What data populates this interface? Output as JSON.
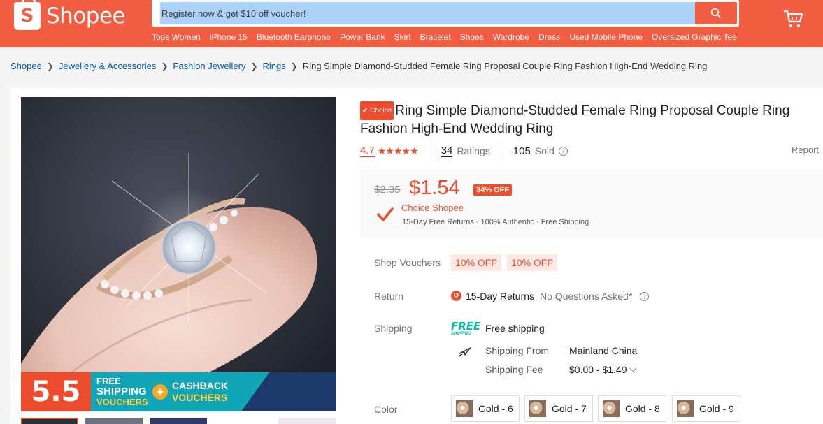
{
  "header": {
    "logo_text": "Shopee",
    "search_placeholder": "Register now & get $10 off voucher!",
    "hot_words": [
      "Tops Women",
      "iPhone 15",
      "Bluetooth Earphone",
      "Power Bank",
      "Skirt",
      "Bracelet",
      "Shoes",
      "Wardrobe",
      "Dress",
      "Used Mobile Phone",
      "Oversized Graphic Tee"
    ]
  },
  "breadcrumb": {
    "items": [
      "Shopee",
      "Jewellery & Accessories",
      "Fashion Jewellery",
      "Rings"
    ],
    "current": "Ring Simple Diamond-Studded Female Ring Proposal Couple Ring Fashion High-End Wedding Ring"
  },
  "product": {
    "badge": "✔ Choice",
    "title": "Ring Simple Diamond-Studded Female Ring Proposal Couple Ring Fashion High-End Wedding Ring",
    "rating": "4.7",
    "stars": 4.7,
    "ratings_count": "34",
    "ratings_label": "Ratings",
    "sold_count": "105",
    "sold_label": "Sold",
    "report": "Report",
    "old_price": "$2.35",
    "price": "$1.54",
    "discount": "34% OFF",
    "choice_title": "Choice Shopee",
    "choice_sub": "15-Day Free Returns · 100% Authentic · Free Shipping"
  },
  "banner": {
    "big": "5.5",
    "left_top": "FREE",
    "left_mid": "SHIPPING",
    "left_bot": "VOUCHERS",
    "right_top": "CASHBACK",
    "right_bot": "VOUCHERS"
  },
  "details": {
    "vouchers_label": "Shop Vouchers",
    "vouchers": [
      "10% OFF",
      "10% OFF"
    ],
    "return_label": "Return",
    "return_value": "15-Day Returns",
    "return_note": "No Questions Asked*",
    "shipping_label": "Shipping",
    "free_logo_top": "FREE",
    "free_logo_bot": "SHIPPING",
    "free_shipping": "Free shipping",
    "shipping_from_label": "Shipping From",
    "shipping_from": "Mainland China",
    "shipping_fee_label": "Shipping Fee",
    "shipping_fee": "$0.00 - $1.49",
    "color_label": "Color",
    "colors": [
      "Gold - 6",
      "Gold - 7",
      "Gold - 8",
      "Gold - 9"
    ]
  },
  "colors": {
    "brand": "#ee4d2d",
    "header": "#f05d40",
    "link": "#0055aa",
    "teal": "#00bfa5"
  }
}
